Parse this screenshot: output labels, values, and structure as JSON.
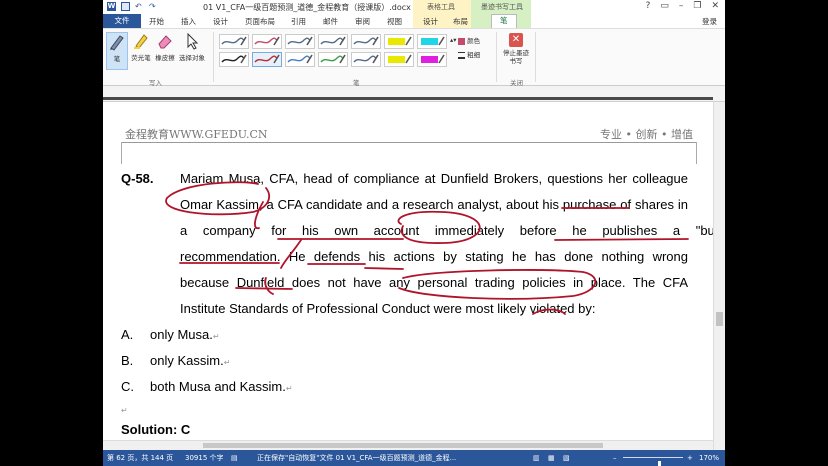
{
  "window": {
    "title": "01 V1_CFA一级百题预测_道德_金程教育（授课版）.docx [兼...",
    "context_tab_1": "表格工具",
    "context_tab_2": "墨迹书写工具",
    "login": "登录",
    "buttons": [
      "?",
      "▭",
      "–",
      "❐",
      "✕"
    ]
  },
  "tabs": [
    "文件",
    "开始",
    "插入",
    "设计",
    "页面布局",
    "引用",
    "邮件",
    "审阅",
    "视图",
    "设计",
    "布局",
    "笔"
  ],
  "active_tab_index": 11,
  "ribbon": {
    "write_tools": [
      {
        "label": "笔",
        "icon": "pen-icon",
        "selected": true
      },
      {
        "label": "荧光笔",
        "icon": "highlighter-icon",
        "selected": false
      },
      {
        "label": "橡皮擦",
        "icon": "eraser-icon",
        "selected": false
      },
      {
        "label": "选择对象",
        "icon": "select-arrow-icon",
        "selected": false
      }
    ],
    "write_group_label": "写入",
    "pens_group_label": "笔",
    "pen_colors": [
      [
        "#556b8a",
        "#c44a6b",
        "#556b8a",
        "#556b8a",
        "#556b8a",
        "#e8e800",
        "#22d4e8"
      ],
      [
        "#222222",
        "#c42a2a",
        "#4a7cc4",
        "#3aa04a",
        "#556b8a",
        "#e8e800",
        "#e020e0"
      ]
    ],
    "selected_pen": [
      1,
      1
    ],
    "color_label": "颜色",
    "weight_label": "粗细",
    "stop_label": "停止墨迹书写",
    "close_group_label": "关闭"
  },
  "document": {
    "header_left": "金程教育WWW.GFEDU.CN",
    "header_right": "专业 • 创新 • 增值",
    "question_number": "Q-58.",
    "question_lines": [
      "Mariam Musa, CFA, head of compliance at Dunfield Brokers, questions her colleague",
      "Omar Kassim, a CFA candidate and a research analyst, about his purchase of shares in",
      "a company for his own account immediately before he publishes a \"buy\"",
      "recommendation. He defends his actions by stating he has done nothing wrong",
      "because Dunfield does not have any personal trading policies in place. The CFA",
      "Institute Standards of Professional Conduct were most likely violated by:"
    ],
    "options": [
      {
        "letter": "A.",
        "text": "only Musa."
      },
      {
        "letter": "B.",
        "text": "only Kassim."
      },
      {
        "letter": "C.",
        "text": "both Musa and Kassim."
      }
    ],
    "solution": "Solution: C"
  },
  "status_bar": {
    "page": "第 62 页，共 144 页",
    "words": "30915 个字",
    "language_icon": "proofing-icon",
    "autosave": "正在保存\"自动恢复\"文件 01 V1_CFA一级百题预测_道德_金程...",
    "zoom_level": "170%",
    "zoom_fraction": 0.62
  }
}
